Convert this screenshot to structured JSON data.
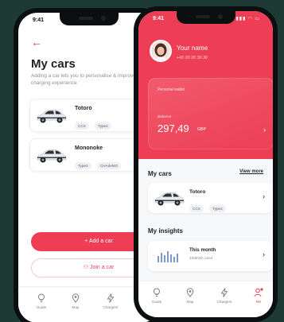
{
  "colors": {
    "accent": "#ee3e55",
    "background": "#1e3a34",
    "text": "#1d2126"
  },
  "back_screen": {
    "status_time": "9:41",
    "back_icon": "arrow-left-icon",
    "title": "My cars",
    "subtitle": "Adding a car lets you to personalise & improve your charging experience.",
    "cars": [
      {
        "name": "Totoro",
        "tags": [
          "CCS",
          "Type2"
        ]
      },
      {
        "name": "Mononoke",
        "tags": [
          "Type2",
          "CHAdeMO"
        ]
      }
    ],
    "add_button": "+ Add a car",
    "join_button": "Join a car",
    "nav": [
      {
        "label": "Guide",
        "icon": "lightbulb-icon"
      },
      {
        "label": "Map",
        "icon": "map-pin-icon"
      },
      {
        "label": "Chargers",
        "icon": "lightning-icon"
      }
    ]
  },
  "front_screen": {
    "status_time": "9:41",
    "profile": {
      "name": "Your name",
      "phone": "+43 20 20 30 30"
    },
    "wallet": {
      "title": "Personal wallet",
      "balance_label": "Balance",
      "amount": "297,49",
      "currency": "GBP"
    },
    "my_cars": {
      "title": "My cars",
      "view_more": "View more",
      "car": {
        "name": "Totoro",
        "tags": [
          "CCS",
          "Type2"
        ]
      }
    },
    "insights": {
      "title": "My insights",
      "card_title": "This month",
      "card_sub": "183kWh used"
    },
    "nav": [
      {
        "label": "Guide",
        "icon": "lightbulb-icon"
      },
      {
        "label": "Map",
        "icon": "map-pin-icon"
      },
      {
        "label": "Chargers",
        "icon": "lightning-icon"
      },
      {
        "label": "Me",
        "icon": "person-icon"
      }
    ]
  }
}
